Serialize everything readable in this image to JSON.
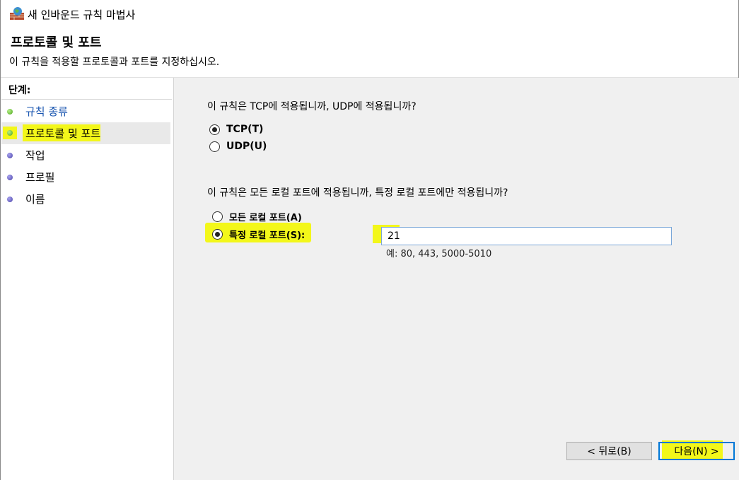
{
  "window": {
    "title": "새 인바운드 규칙 마법사"
  },
  "header": {
    "title": "프로토콜 및 포트",
    "description": "이 규칙을 적용할 프로토콜과 포트를 지정하십시오."
  },
  "steps": {
    "label": "단계:",
    "items": [
      {
        "label": "규칙 종류",
        "state": "done",
        "icon": "green-dot-icon"
      },
      {
        "label": "프로토콜 및 포트",
        "state": "current",
        "icon": "green-dot-icon"
      },
      {
        "label": "작업",
        "state": "pending",
        "icon": "purple-dot-icon"
      },
      {
        "label": "프로필",
        "state": "pending",
        "icon": "purple-dot-icon"
      },
      {
        "label": "이름",
        "state": "pending",
        "icon": "purple-dot-icon"
      }
    ]
  },
  "protocol": {
    "question": "이 규칙은 TCP에 적용됩니까, UDP에 적용됩니까?",
    "tcp_label": "TCP(T)",
    "udp_label": "UDP(U)",
    "selected": "TCP(T)"
  },
  "ports": {
    "question": "이 규칙은 모든 로컬 포트에 적용됩니까, 특정 로컬 포트에만 적용됩니까?",
    "all_label": "모든 로컬 포트(A)",
    "specific_label": "특정 로컬 포트(S):",
    "selected": "특정 로컬 포트(S):",
    "value": "21",
    "hint": "예: 80, 443, 5000-5010"
  },
  "buttons": {
    "back": "< 뒤로(B)",
    "next": "다음(N) >"
  },
  "colors": {
    "highlight": "#f3f71a",
    "link": "#1a56b0",
    "focus": "#0078d7"
  }
}
